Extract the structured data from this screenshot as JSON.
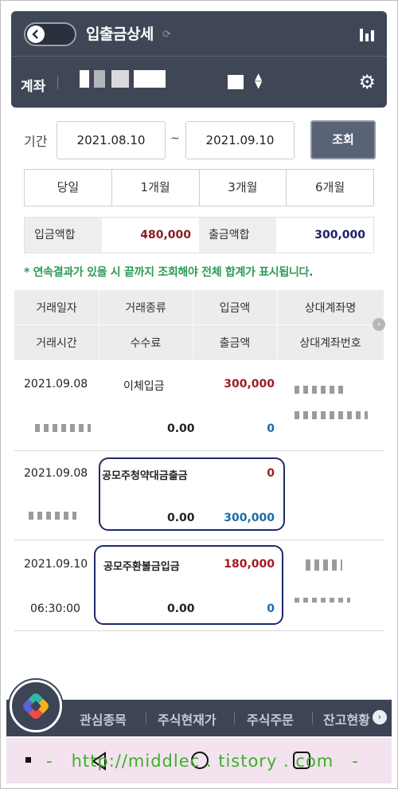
{
  "header": {
    "title": "입출금상세",
    "account_label": "계좌"
  },
  "period": {
    "label": "기간",
    "from": "2021.08.10",
    "to": "2021.09.10",
    "separator": "~",
    "search_label": "조회"
  },
  "quick_tabs": [
    "당일",
    "1개월",
    "3개월",
    "6개월"
  ],
  "sums": {
    "deposit_label": "입금액합",
    "deposit_value": "480,000",
    "withdraw_label": "출금액합",
    "withdraw_value": "300,000"
  },
  "notice": "* 연속결과가 있을 시 끝까지 조회해야 전체 합계가 표시됩니다.",
  "table": {
    "headers_row1": [
      "거래일자",
      "거래종류",
      "입금액",
      "상대계좌명"
    ],
    "headers_row2": [
      "거래시간",
      "수수료",
      "출금액",
      "상대계좌번호"
    ],
    "rows": [
      {
        "date": "2021.09.08",
        "time": "",
        "type": "이체입금",
        "fee": "0.00",
        "deposit": "300,000",
        "withdraw": "0"
      },
      {
        "date": "2021.09.08",
        "time": "",
        "type": "공모주청약대금출금",
        "fee": "0.00",
        "deposit": "0",
        "withdraw": "300,000"
      },
      {
        "date": "2021.09.10",
        "time": "06:30:00",
        "type": "공모주환불금입금",
        "fee": "0.00",
        "deposit": "180,000",
        "withdraw": "0"
      }
    ]
  },
  "menu": [
    "관심종목",
    "주식현재가",
    "주식주문",
    "잔고현황"
  ],
  "watermark": "-   http://middlec . tistory . com   -",
  "colors": {
    "header_bg": "#3f4757",
    "deposit": "#a01c22",
    "withdraw": "#1b6ba8",
    "notice": "#2b9b55"
  }
}
